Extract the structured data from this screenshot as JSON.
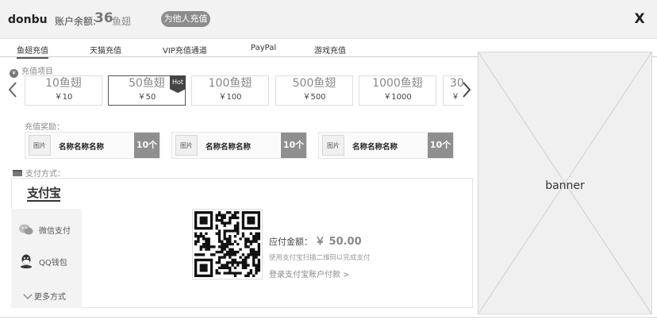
{
  "header": {
    "brand": "donbu",
    "balance_label": "账户余额:",
    "balance_value": "36",
    "balance_unit": "鱼翅",
    "recharge_other": "为他人充值",
    "close": "X"
  },
  "tabs": [
    {
      "label": "鱼翅充值",
      "active": true
    },
    {
      "label": "天猫充值",
      "active": false
    },
    {
      "label": "VIP充值通道",
      "active": false
    },
    {
      "label": "PayPal",
      "active": false
    },
    {
      "label": "游戏充值",
      "active": false
    }
  ],
  "recharge_items": {
    "title": "充值项目",
    "items": [
      {
        "name": "10鱼翅",
        "price": "￥10",
        "selected": false
      },
      {
        "name": "50鱼翅",
        "price": "￥50",
        "selected": true
      },
      {
        "name": "100鱼翅",
        "price": "￥100",
        "selected": false
      },
      {
        "name": "500鱼翅",
        "price": "￥500",
        "selected": false
      },
      {
        "name": "1000鱼翅",
        "price": "￥1000",
        "selected": false
      },
      {
        "name": "30",
        "price": "￥",
        "selected": false
      }
    ],
    "hot_badge": "Hot"
  },
  "rewards": {
    "title": "充值奖励：",
    "items": [
      {
        "image_label": "图片",
        "name": "名称名称名称",
        "count": "10个"
      },
      {
        "image_label": "图片",
        "name": "名称名称名称",
        "count": "10个"
      },
      {
        "image_label": "图片",
        "name": "名称名称名称",
        "count": "10个"
      }
    ]
  },
  "payment": {
    "title": "支付方式：",
    "alipay_logo": "支付宝",
    "methods": [
      {
        "label": "微信支付",
        "icon": "wechat-icon"
      },
      {
        "label": "QQ钱包",
        "icon": "qq-wallet-icon"
      }
    ],
    "more": "更多方式",
    "amount_label": "应付金额：",
    "amount_value": "￥ 50.00",
    "hint": "使用支付宝扫描二维码以完成支付",
    "login_link": "登录支付宝账户付款 >"
  },
  "banner": {
    "label": "banner"
  },
  "colors": {
    "header_bg": "#f2f2f2",
    "accent_gray": "#8f8f8f",
    "hot_badge": "#444444",
    "selected_border": "#555555"
  }
}
